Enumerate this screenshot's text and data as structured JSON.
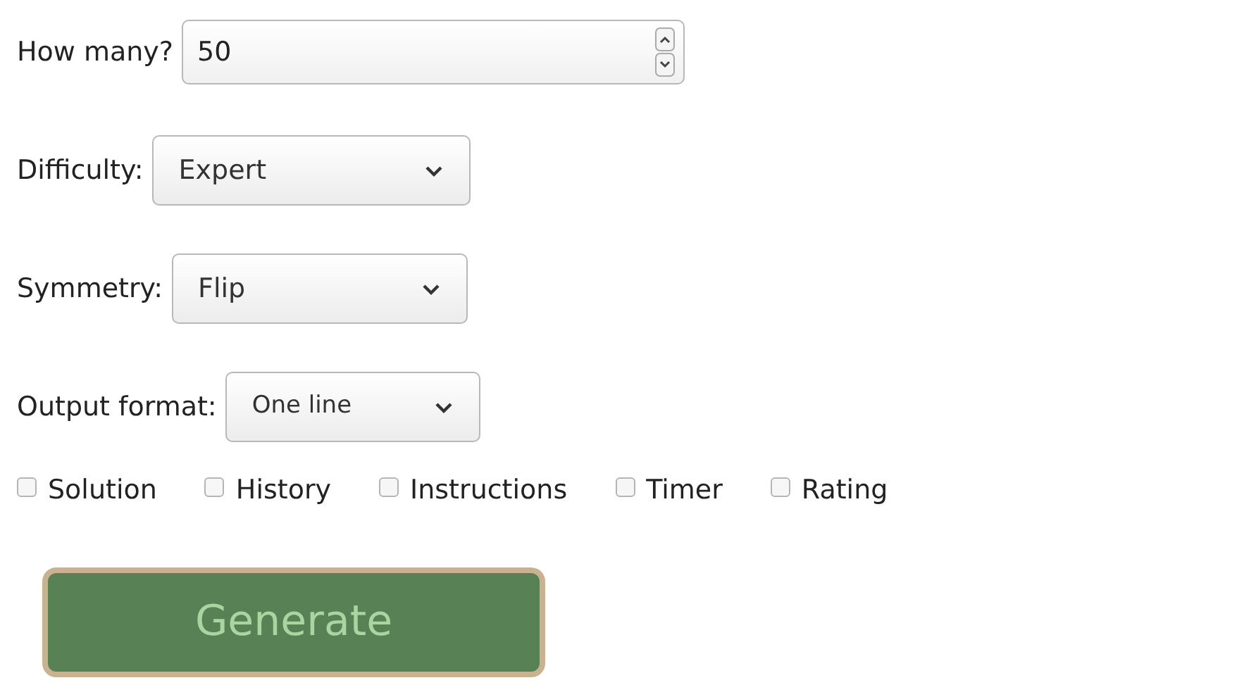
{
  "fields": [
    {
      "kind": "number",
      "label": "How many?",
      "value": "50"
    },
    {
      "kind": "select",
      "label": "Difficulty:",
      "value": "Expert"
    },
    {
      "kind": "select",
      "label": "Symmetry:",
      "value": "Flip"
    },
    {
      "kind": "select",
      "label": "Output format:",
      "value": "One line"
    }
  ],
  "options": [
    {
      "label": "Solution",
      "checked": false
    },
    {
      "label": "History",
      "checked": false
    },
    {
      "label": "Instructions",
      "checked": false
    },
    {
      "label": "Timer",
      "checked": false
    },
    {
      "label": "Rating",
      "checked": false
    }
  ],
  "button": {
    "label": "Generate"
  }
}
